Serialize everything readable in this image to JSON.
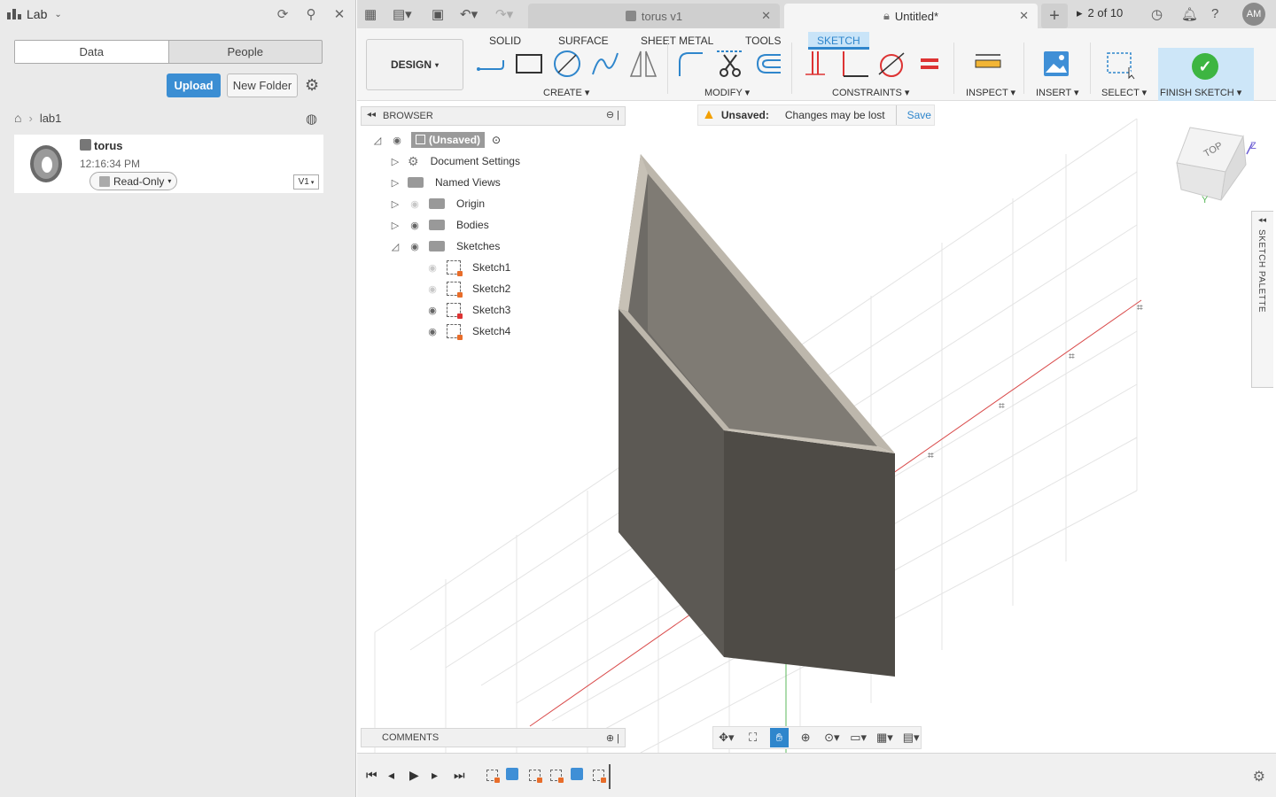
{
  "data_panel": {
    "project": "Lab",
    "tabs": [
      "Data",
      "People"
    ],
    "upload": "Upload",
    "new_folder": "New Folder",
    "breadcrumb_folder": "lab1",
    "file": {
      "name": "torus",
      "time": "12:16:34 PM",
      "access": "Read-Only",
      "version": "V1"
    }
  },
  "appbar": {
    "tab_inactive": "torus v1",
    "tab_active": "Untitled*",
    "pager": "2 of 10",
    "avatar": "AM"
  },
  "ribbon": {
    "workspace": "DESIGN",
    "tabs": [
      "SOLID",
      "SURFACE",
      "SHEET METAL",
      "TOOLS",
      "SKETCH"
    ],
    "groups": {
      "create": "CREATE",
      "modify": "MODIFY",
      "constraints": "CONSTRAINTS",
      "inspect": "INSPECT",
      "insert": "INSERT",
      "select": "SELECT",
      "finish": "FINISH SKETCH"
    }
  },
  "browser": {
    "title": "BROWSER",
    "root": "(Unsaved)",
    "items": [
      "Document Settings",
      "Named Views",
      "Origin",
      "Bodies",
      "Sketches"
    ],
    "sketches": [
      "Sketch1",
      "Sketch2",
      "Sketch3",
      "Sketch4"
    ]
  },
  "notice": {
    "label": "Unsaved:",
    "message": "Changes may be lost",
    "action": "Save"
  },
  "viewcube": {
    "face": "TOP",
    "axis_z": "Z",
    "axis_y": "Y"
  },
  "sketch_palette": "SKETCH PALETTE",
  "comments": "COMMENTS",
  "colors": {
    "accent": "#2f86cc",
    "finish_green": "#3db542",
    "body": "#595650",
    "x_axis": "#d94a4a",
    "y_axis": "#5cb85c"
  }
}
